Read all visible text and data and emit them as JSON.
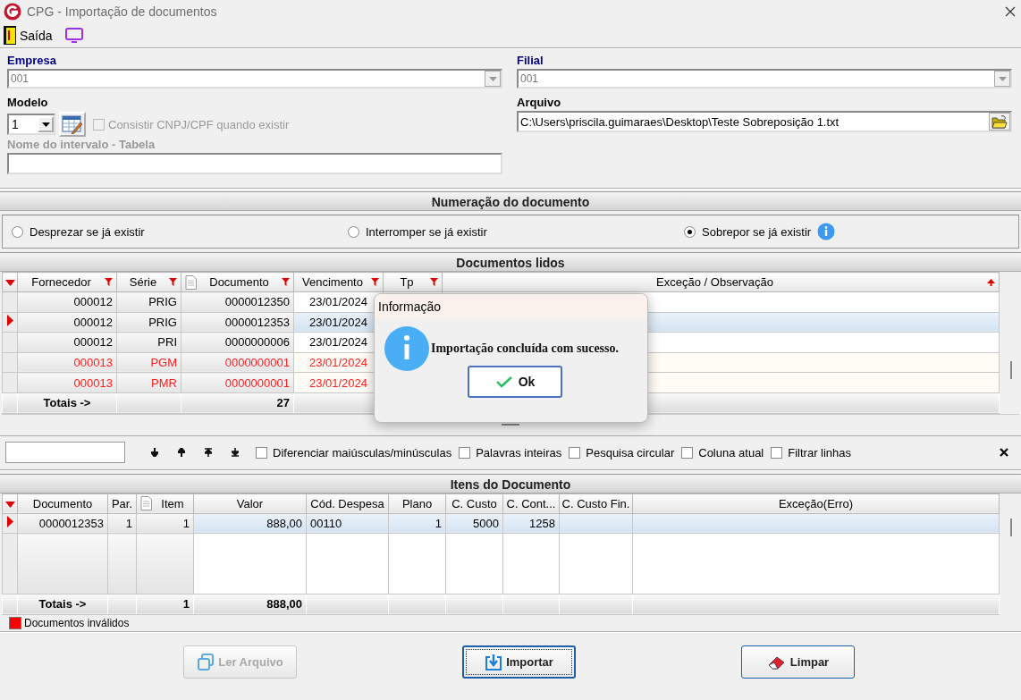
{
  "window": {
    "title": "CPG - Importação de documentos"
  },
  "toolbar": {
    "exit_label": "Saída"
  },
  "form": {
    "empresa": {
      "label": "Empresa",
      "value": "001"
    },
    "filial": {
      "label": "Filial",
      "value": "001"
    },
    "modelo": {
      "label": "Modelo",
      "value": "1"
    },
    "consistir": {
      "label": "Consistir CNPJ/CPF quando existir",
      "checked": false,
      "disabled": true
    },
    "intervalo": {
      "label": "Nome do intervalo - Tabela",
      "disabled": true
    },
    "arquivo": {
      "label": "Arquivo",
      "value": "C:\\Users\\priscila.guimaraes\\Desktop\\Teste Sobreposição 1.txt"
    }
  },
  "numeracao": {
    "title": "Numeração do documento",
    "options": [
      {
        "label": "Desprezar se já existir",
        "selected": false
      },
      {
        "label": "Interromper se já existir",
        "selected": false
      },
      {
        "label": "Sobrepor se já existir",
        "selected": true
      }
    ]
  },
  "documentos": {
    "title": "Documentos lidos",
    "columns": [
      {
        "label": "Fornecedor",
        "filter": true
      },
      {
        "label": "Série",
        "filter": true
      },
      {
        "label": "Documento",
        "filter": true,
        "page_icon": true,
        "total": "27"
      },
      {
        "label": "Vencimento",
        "filter": true
      },
      {
        "label": "Tp",
        "filter": true
      },
      {
        "label": "Exceção / Observação",
        "filter": false
      }
    ],
    "rows": [
      {
        "cells": [
          "000012",
          "PRIG",
          "0000012350",
          "23/01/2024",
          "",
          ""
        ],
        "selected": false,
        "invalid": false
      },
      {
        "cells": [
          "000012",
          "PRIG",
          "0000012353",
          "23/01/2024",
          "",
          ""
        ],
        "selected": true,
        "invalid": false
      },
      {
        "cells": [
          "000012",
          "PRI",
          "0000000006",
          "23/01/2024",
          "",
          ""
        ],
        "selected": false,
        "invalid": false
      },
      {
        "cells": [
          "000013",
          "PGM",
          "0000000001",
          "23/01/2024",
          "",
          ""
        ],
        "selected": false,
        "invalid": true
      },
      {
        "cells": [
          "000013",
          "PMR",
          "0000000001",
          "23/01/2024",
          "",
          ""
        ],
        "selected": false,
        "invalid": true
      }
    ],
    "totals_label": "Totais ->"
  },
  "search": {
    "options": [
      {
        "label": "Diferenciar maiúsculas/minúsculas",
        "checked": false
      },
      {
        "label": "Palavras inteiras",
        "checked": false
      },
      {
        "label": "Pesquisa circular",
        "checked": false
      },
      {
        "label": "Coluna atual",
        "checked": false
      },
      {
        "label": "Filtrar linhas",
        "checked": false
      }
    ]
  },
  "itens": {
    "title": "Itens do Documento",
    "columns": [
      {
        "label": "Documento"
      },
      {
        "label": "Par."
      },
      {
        "label": "Item",
        "page_icon": true,
        "total": "1"
      },
      {
        "label": "Valor",
        "total": "888,00"
      },
      {
        "label": "Cód. Despesa"
      },
      {
        "label": "Plano"
      },
      {
        "label": "C. Custo"
      },
      {
        "label": "C. Cont..."
      },
      {
        "label": "C. Custo Fin."
      },
      {
        "label": "Exceção(Erro)"
      }
    ],
    "rows": [
      {
        "cells": [
          "0000012353",
          "1",
          "1",
          "888,00",
          "00110",
          "1",
          "5000",
          "1258",
          "",
          ""
        ],
        "selected": true,
        "invalid": false
      }
    ],
    "totals_label": "Totais ->"
  },
  "legend": {
    "label": "Documentos inválidos",
    "color": "#ff0000"
  },
  "buttons": [
    {
      "label": "Ler Arquivo",
      "kind": "read",
      "disabled": true,
      "focused": false
    },
    {
      "label": "Importar",
      "kind": "import",
      "disabled": false,
      "focused": true
    },
    {
      "label": "Limpar",
      "kind": "clear",
      "disabled": false,
      "focused": false
    }
  ],
  "dialog": {
    "title": "Informação",
    "message": "Importação concluída com sucesso.",
    "button": "Ok"
  }
}
